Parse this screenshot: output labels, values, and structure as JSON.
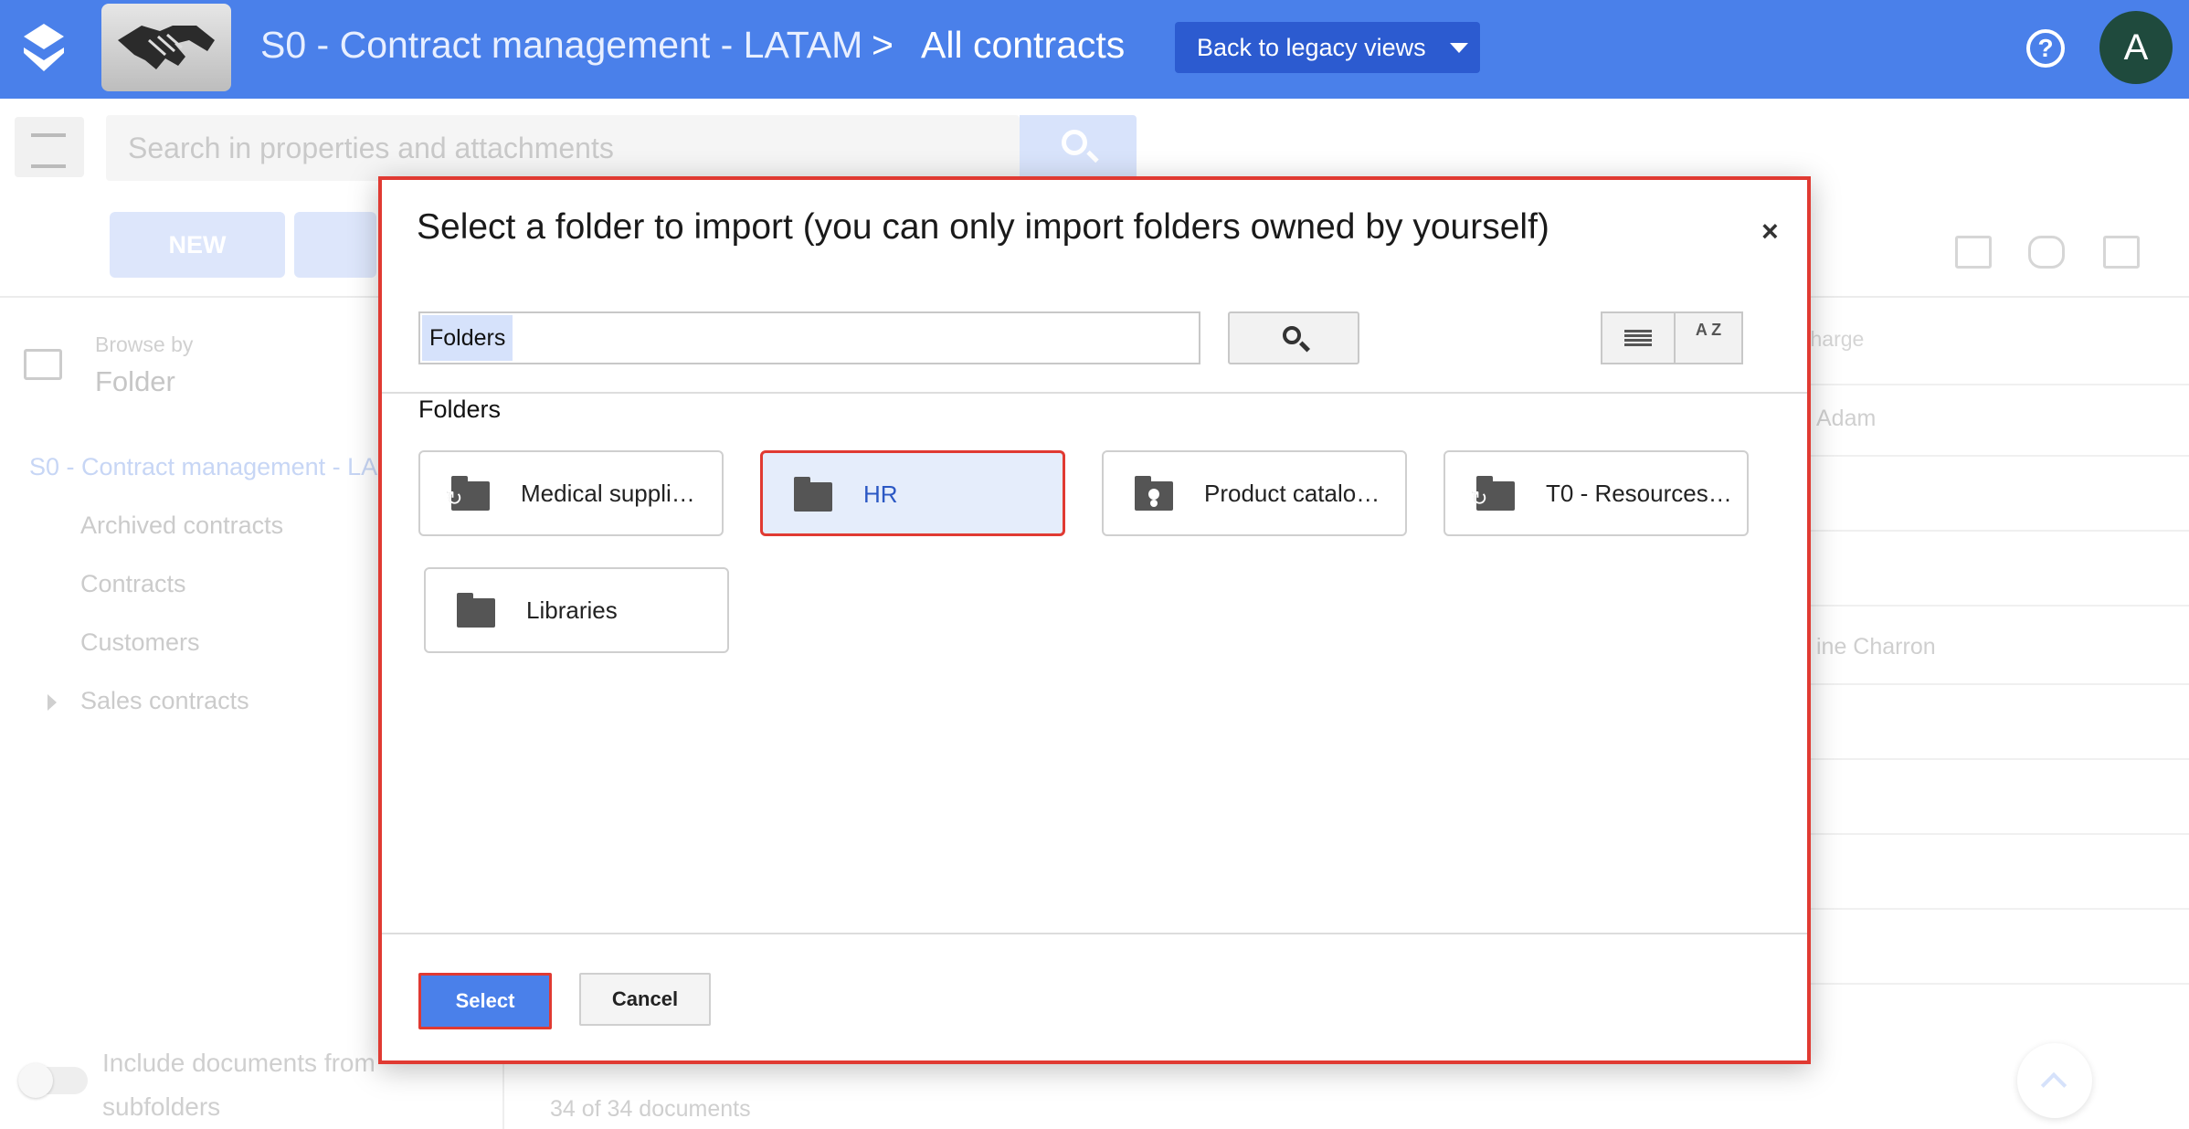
{
  "header": {
    "app_name": "S0 - Contract management - LATAM",
    "separator": ">",
    "page_title": "All contracts",
    "legacy_button": "Back to legacy views",
    "avatar_initial": "A",
    "color": "#4a80ea"
  },
  "toolbar": {
    "search_placeholder": "Search in properties and attachments",
    "new_label": "NEW"
  },
  "sidebar": {
    "browse_label": "Browse by",
    "browse_value": "Folder",
    "root": "S0 - Contract management - LA",
    "items": [
      "Archived contracts",
      "Contracts",
      "Customers",
      "Sales contracts"
    ],
    "include_line1": "Include documents from",
    "include_line2": "subfolders"
  },
  "table": {
    "column_charge": "charge",
    "rows": [
      "Adam",
      "ine Charron"
    ],
    "count": "34 of 34 documents"
  },
  "dialog": {
    "title": "Select a folder to import (you can only import folders owned by yourself)",
    "close": "×",
    "search_chip": "Folders",
    "sort_label": "A Z",
    "section": "Folders",
    "folders": [
      {
        "name": "Medical suppli…",
        "icon": "sync-folder-icon"
      },
      {
        "name": "HR",
        "icon": "folder-icon",
        "selected": true
      },
      {
        "name": "Product catalo…",
        "icon": "shared-folder-icon"
      },
      {
        "name": "T0 - Resources…",
        "icon": "sync-folder-icon"
      },
      {
        "name": "Libraries",
        "icon": "folder-icon"
      }
    ],
    "select_label": "Select",
    "cancel_label": "Cancel",
    "highlight_color": "#e03a32"
  }
}
